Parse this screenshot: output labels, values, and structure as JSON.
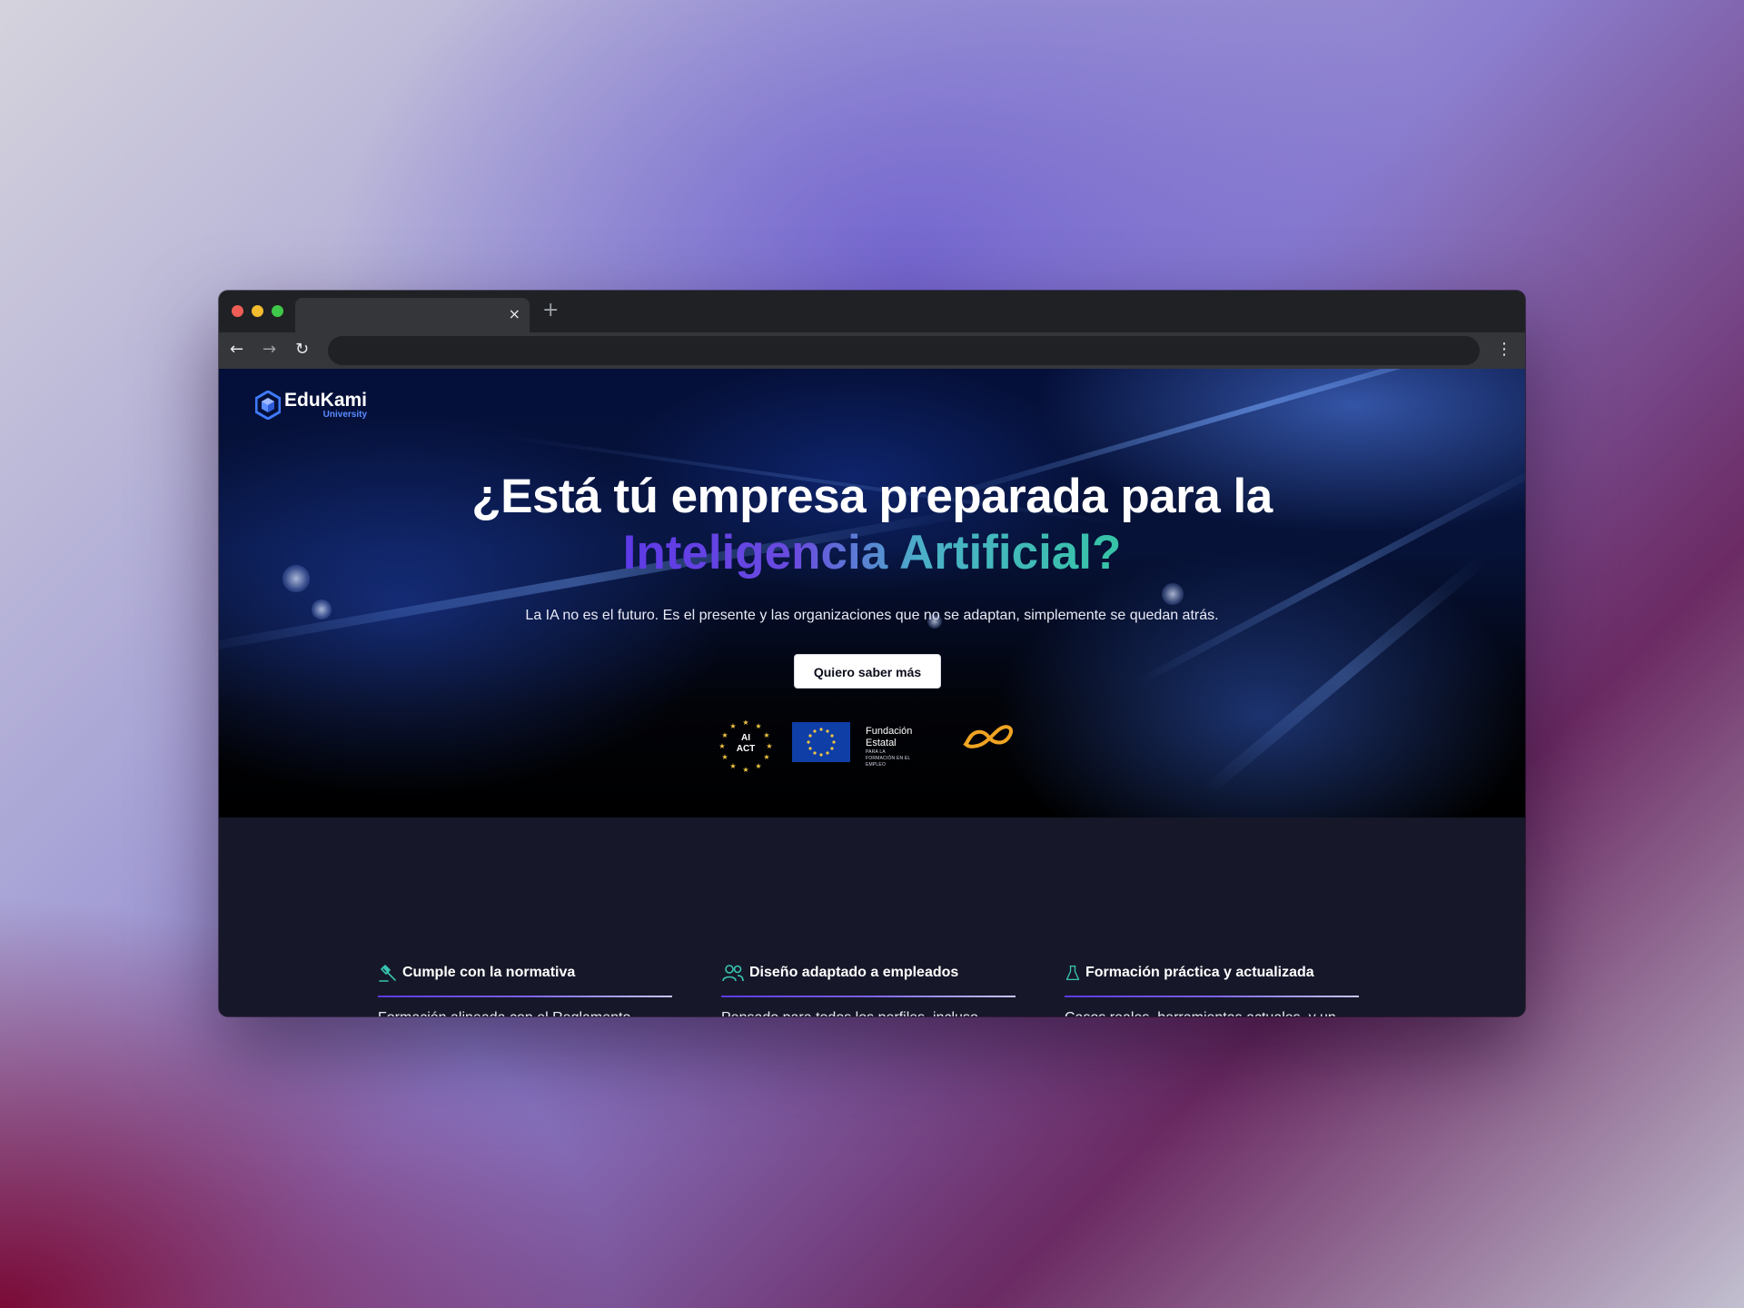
{
  "browser": {
    "tab_title": "",
    "tab_close": "×",
    "new_tab": "+",
    "back": "←",
    "forward": "→",
    "reload": "↻",
    "address": "",
    "menu": "⋮"
  },
  "site": {
    "logo_name": "EduKami",
    "logo_sub": "University",
    "logo_icon": "hexagon-cube-icon"
  },
  "hero": {
    "headline": "¿Está tú empresa preparada para la",
    "headline_accent": "Inteligencia Artificial?",
    "subtitle": "La IA no es el futuro. Es el presente y las organizaciones que no se adaptan, simplemente se quedan atrás.",
    "cta": "Quiero saber más",
    "badges": {
      "ai_act": "AI\nACT",
      "ai_act_line1": "AI",
      "ai_act_line2": "ACT",
      "fundacion_name": "Fundación Estatal",
      "fundacion_sub": "PARA LA FORMACIÓN EN EL EMPLEO"
    },
    "colors": {
      "accent_start": "#5e39e6",
      "accent_end": "#36c4a6"
    }
  },
  "features": [
    {
      "icon": "gavel-icon",
      "title": "Cumple con la normativa",
      "desc": "Formación alineada con el Reglamento"
    },
    {
      "icon": "users-icon",
      "title": "Diseño adaptado a empleados",
      "desc": "Pensado para todos los perfiles, incluso"
    },
    {
      "icon": "flask-icon",
      "title": "Formación práctica y actualizada",
      "desc": "Casos reales, herramientas actuales, y un"
    }
  ]
}
